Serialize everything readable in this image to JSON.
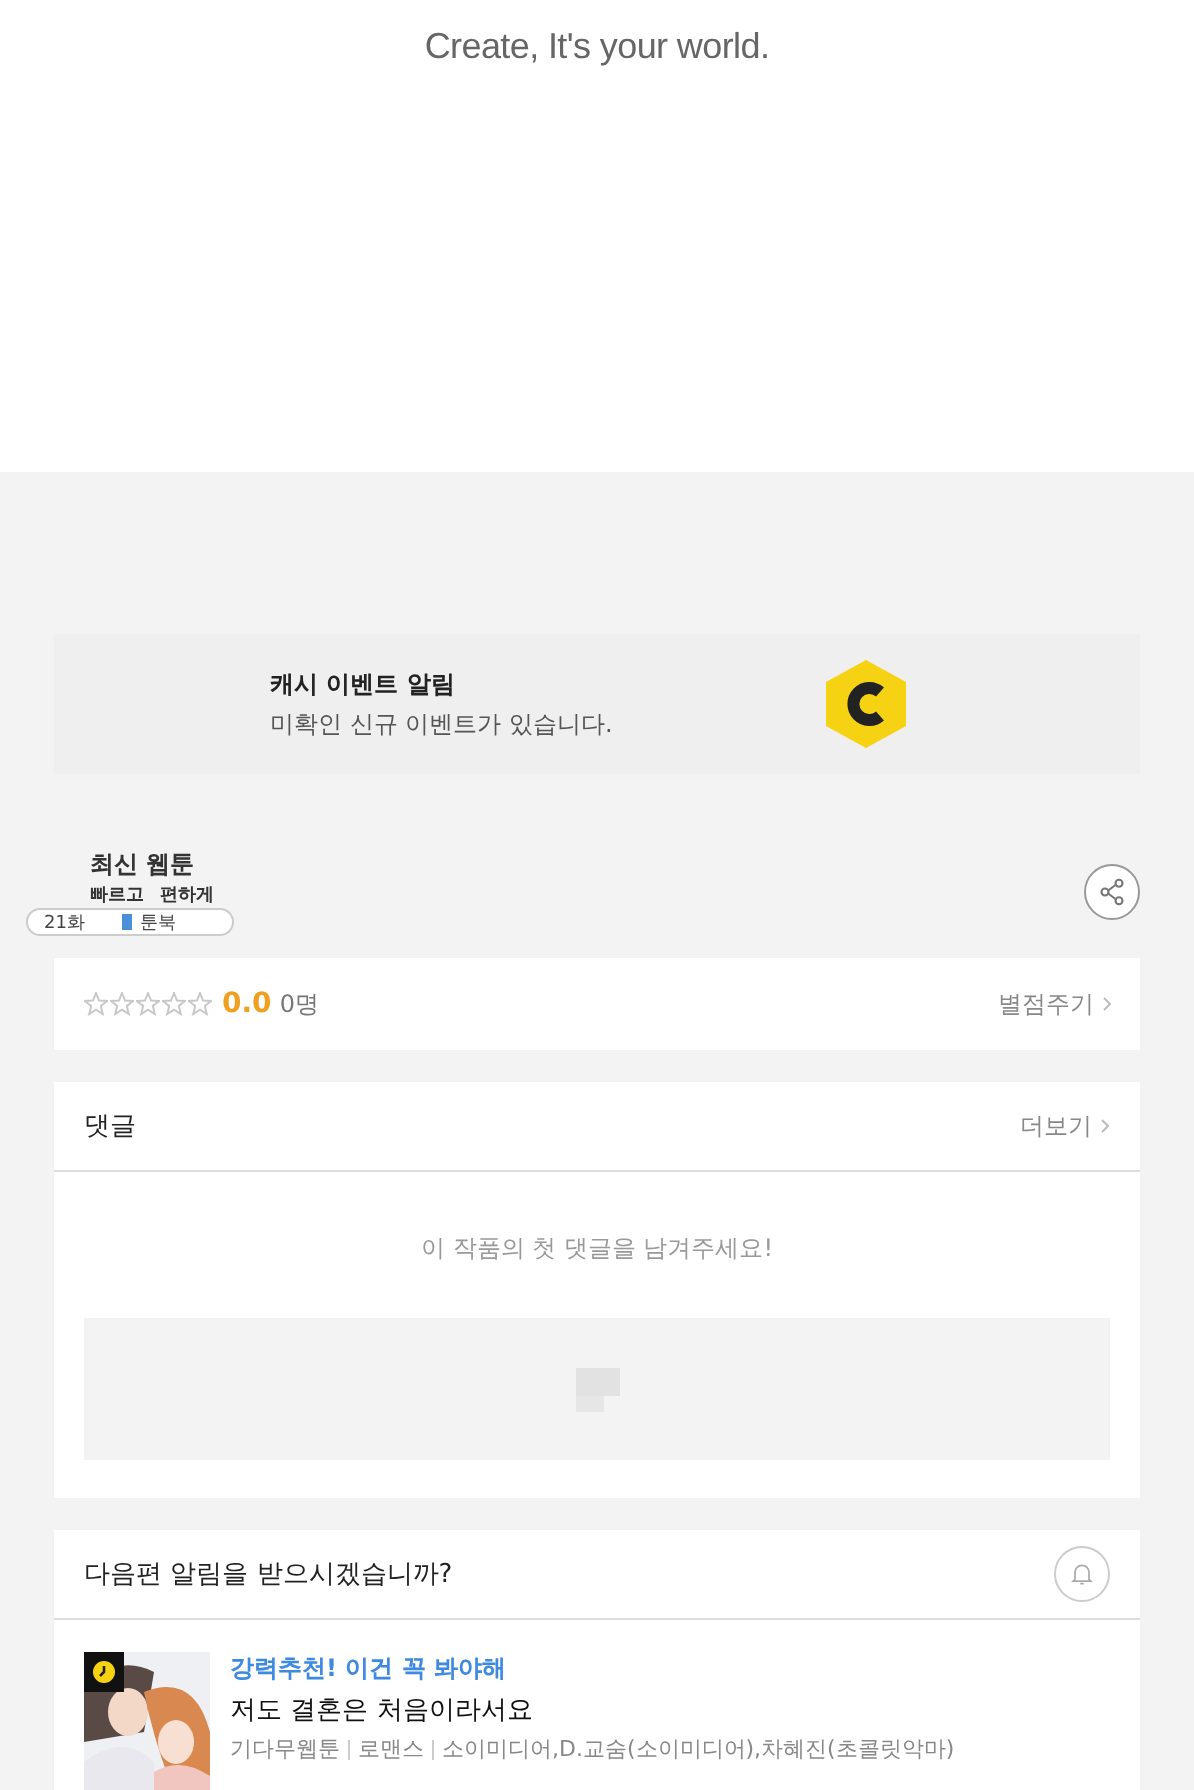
{
  "header": {
    "slogan": "Create, It's your world."
  },
  "cash_banner": {
    "title": "캐시 이벤트 알림",
    "message": "미확인 신규 이벤트가 있습니다."
  },
  "title_block": {
    "label": "최신 웹툰",
    "tagline_1": "빠르고",
    "tagline_2": "편하게",
    "episode": "21화",
    "badge": "툰북"
  },
  "rating": {
    "stars": 0,
    "score": "0.0",
    "count": "0명",
    "action": "별점주기"
  },
  "comments": {
    "title": "댓글",
    "more": "더보기",
    "empty": "이 작품의 첫 댓글을 남겨주세요!"
  },
  "notify": {
    "question": "다음편 알림을 받으시겠습니까?",
    "item": {
      "tag": "강력추천! 이건 꼭 봐야해",
      "title": "저도 결혼은 처음이라서요",
      "meta": [
        "기다무웹툰",
        "로맨스",
        "소이미디어,D.교숨(소이미디어),차혜진(초콜릿악마)"
      ]
    }
  }
}
